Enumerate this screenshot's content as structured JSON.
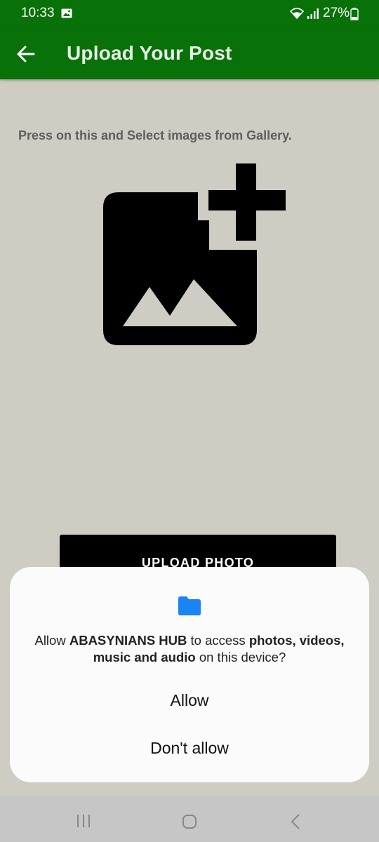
{
  "status_bar": {
    "time": "10:33",
    "battery": "27%",
    "icons": [
      "image-notification-icon",
      "wifi-icon",
      "signal-icon",
      "battery-icon"
    ]
  },
  "app_bar": {
    "title": "Upload Your Post",
    "back_icon": "back-arrow-icon",
    "color": "#087108"
  },
  "main": {
    "instruction": "Press on this and Select images from Gallery.",
    "picker_icon": "add-photo-icon",
    "upload_button_label": "UPLOAD PHOTO"
  },
  "dialog": {
    "icon": "folder-icon",
    "message_parts": {
      "prefix": "Allow ",
      "app_name": "ABASYNIANS HUB",
      "middle": " to access ",
      "media": "photos, videos, music and audio",
      "suffix": " on this device?"
    },
    "allow_label": "Allow",
    "deny_label": "Don't allow",
    "accent": "#1a84f5"
  },
  "nav_bar": {
    "icons": [
      "recent-apps-icon",
      "home-icon",
      "back-icon"
    ]
  }
}
